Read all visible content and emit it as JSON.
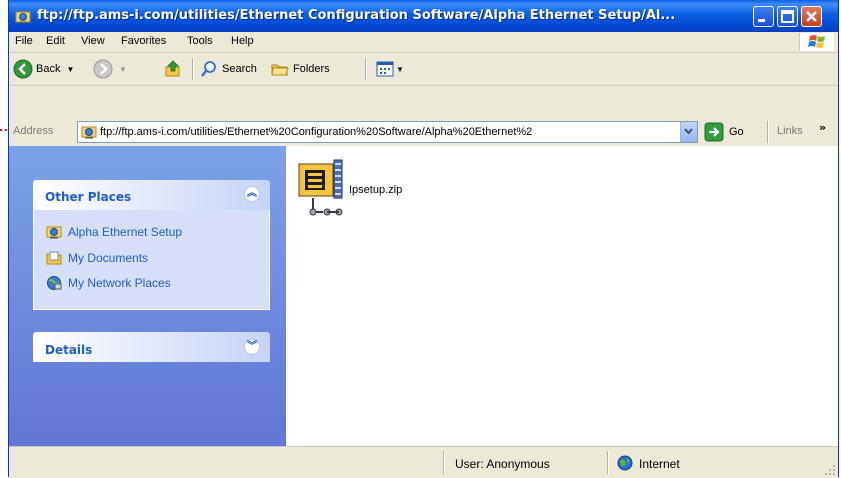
{
  "window": {
    "title": "ftp://ftp.ams-i.com/utilities/Ethernet Configuration Software/Alpha Ethernet Setup/Al..."
  },
  "menu": [
    "File",
    "Edit",
    "View",
    "Favorites",
    "Tools",
    "Help"
  ],
  "toolbar": {
    "back_label": "Back",
    "search_label": "Search",
    "folders_label": "Folders"
  },
  "address": {
    "label": "Address",
    "value": "ftp://ftp.ams-i.com/utilities/Ethernet%20Configuration%20Software/Alpha%20Ethernet%2",
    "go_label": "Go",
    "links_label": "Links"
  },
  "taskpane": {
    "other_places": {
      "title": "Other Places",
      "items": [
        {
          "label": "Alpha Ethernet Setup",
          "icon": "ftp-folder-icon"
        },
        {
          "label": "My Documents",
          "icon": "my-documents-icon"
        },
        {
          "label": "My Network Places",
          "icon": "network-places-icon"
        }
      ]
    },
    "details": {
      "title": "Details"
    }
  },
  "files": [
    {
      "name": "Ipsetup.zip",
      "icon": "zip-archive-icon"
    }
  ],
  "status": {
    "user": "User: Anonymous",
    "zone": "Internet"
  },
  "colors": {
    "titlebar": "#0b5fe5",
    "taskpane_link": "#215dc6",
    "taskpane_bg": "#7ba2e7"
  }
}
